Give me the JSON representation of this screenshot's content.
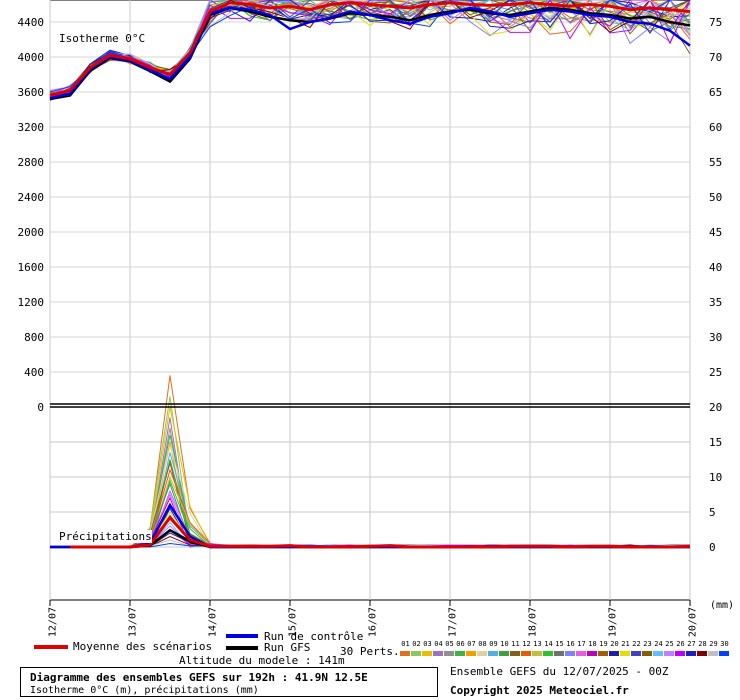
{
  "chart_data": {
    "type": "line",
    "title": "Diagramme des ensembles GEFS sur 192h : 41.9N 12.5E",
    "subtitle": "Isotherme 0°C (m), précipitations (mm)",
    "panels": [
      {
        "name": "Isotherme 0°C",
        "ylabel": "m",
        "yticks": [
          0,
          400,
          800,
          1200,
          1600,
          2000,
          2400,
          2800,
          3200,
          3600,
          4000,
          4400
        ],
        "ylim": [
          0,
          4600
        ],
        "x": [
          "12/07 00",
          "12/07 06",
          "12/07 12",
          "12/07 18",
          "13/07 00",
          "13/07 06",
          "13/07 12",
          "13/07 18",
          "14/07 00",
          "14/07 06",
          "14/07 12",
          "14/07 18",
          "15/07 00",
          "15/07 06",
          "15/07 12",
          "15/07 18",
          "16/07 00",
          "16/07 06",
          "16/07 12",
          "16/07 18",
          "17/07 00",
          "17/07 06",
          "17/07 12",
          "17/07 18",
          "18/07 00",
          "18/07 06",
          "18/07 12",
          "18/07 18",
          "19/07 00",
          "19/07 06",
          "19/07 12",
          "19/07 18",
          "20/07 00"
        ],
        "series": [
          {
            "name": "Moyenne des scénarios",
            "values": [
              3560,
              3620,
              3880,
              4020,
              3980,
              3880,
              3800,
              4050,
              4520,
              4620,
              4600,
              4560,
              4580,
              4540,
              4600,
              4620,
              4600,
              4580,
              4560,
              4600,
              4620,
              4600,
              4590,
              4600,
              4620,
              4600,
              4580,
              4600,
              4580,
              4540,
              4560,
              4540,
              4520
            ]
          },
          {
            "name": "Run de contrôle",
            "values": [
              3530,
              3580,
              3860,
              4000,
              3960,
              3850,
              3750,
              4000,
              4500,
              4560,
              4540,
              4480,
              4320,
              4400,
              4450,
              4520,
              4480,
              4420,
              4380,
              4460,
              4500,
              4560,
              4520,
              4460,
              4500,
              4540,
              4520,
              4480,
              4460,
              4400,
              4380,
              4300,
              4130
            ]
          },
          {
            "name": "Run GFS",
            "values": [
              3520,
              3560,
              3840,
              3990,
              3950,
              3840,
              3720,
              3980,
              4480,
              4560,
              4520,
              4460,
              4420,
              4400,
              4440,
              4500,
              4480,
              4460,
              4420,
              4480,
              4520,
              4540,
              4500,
              4480,
              4520,
              4560,
              4540,
              4500,
              4480,
              4440,
              4460,
              4400,
              4360
            ]
          }
        ]
      },
      {
        "name": "Précipitations",
        "ylabel": "mm",
        "yticks": [
          0,
          5,
          10,
          15,
          20
        ],
        "ylim": [
          0,
          20
        ],
        "x": [
          "12/07 00",
          "12/07 06",
          "12/07 12",
          "12/07 18",
          "13/07 00",
          "13/07 06",
          "13/07 12",
          "13/07 18",
          "14/07 00",
          "14/07 06",
          "14/07 12",
          "14/07 18",
          "15/07 00",
          "15/07 06",
          "15/07 12",
          "15/07 18",
          "16/07 00",
          "16/07 06",
          "16/07 12",
          "16/07 18",
          "17/07 00",
          "17/07 06",
          "17/07 12",
          "17/07 18",
          "18/07 00",
          "18/07 06",
          "18/07 12",
          "18/07 18",
          "19/07 00",
          "19/07 06",
          "19/07 12",
          "19/07 18",
          "20/07 00"
        ],
        "series": [
          {
            "name": "Moyenne des scénarios",
            "values": [
              0,
              0,
              0,
              0,
              0,
              0.3,
              4.2,
              1.0,
              0.1,
              0.1,
              0.1,
              0.1,
              0.2,
              0,
              0,
              0,
              0.1,
              0.2,
              0,
              0,
              0,
              0,
              0,
              0.1,
              0.1,
              0.1,
              0,
              0.1,
              0.1,
              0,
              0,
              0,
              0.1
            ]
          },
          {
            "name": "Run de contrôle",
            "values": [
              0,
              0,
              0,
              0,
              0,
              0.5,
              6.0,
              1.5,
              0,
              0,
              0,
              0,
              0,
              0,
              0,
              0,
              0,
              0,
              0,
              0,
              0,
              0,
              0,
              0,
              0,
              0,
              0,
              0,
              0,
              0,
              0,
              0,
              0
            ]
          },
          {
            "name": "Run GFS",
            "values": [
              0,
              0,
              0,
              0,
              0,
              0.2,
              2.4,
              0.8,
              0,
              0,
              0,
              0,
              0,
              0,
              0,
              0,
              0,
              0,
              0,
              0,
              0,
              0,
              0,
              0,
              0,
              0,
              0,
              0,
              0,
              0,
              0,
              0,
              0
            ]
          }
        ],
        "members_peak_13_07_12h": [
          24.5,
          21.5,
          20,
          18.5,
          17,
          16,
          15,
          14.5,
          13.5,
          12.5,
          12,
          11,
          10,
          9.5,
          9,
          8,
          7.5,
          7,
          6,
          5.5,
          5,
          4.5,
          4,
          3.5,
          3,
          2.5,
          2,
          1.5,
          1,
          0.5
        ]
      }
    ],
    "right_axis_ticks": [
      0,
      5,
      10,
      15,
      20,
      25,
      30,
      35,
      40,
      45,
      50,
      55,
      60,
      65,
      70,
      75
    ],
    "x_tick_labels": [
      "12/07",
      "13/07",
      "14/07",
      "15/07",
      "16/07",
      "17/07",
      "18/07",
      "19/07",
      "20/07"
    ],
    "right_unit_label": "(mm)",
    "grid": true,
    "legend": {
      "mean": "Moyenne des scénarios",
      "control": "Run de contrôle",
      "gfs": "Run GFS",
      "altitude": "Altitude du modele : 141m",
      "perts_label": "30 Perts.",
      "member_numbers": [
        "01",
        "02",
        "03",
        "04",
        "05",
        "06",
        "07",
        "08",
        "09",
        "10",
        "11",
        "12",
        "13",
        "14",
        "15",
        "16",
        "17",
        "18",
        "19",
        "20",
        "21",
        "22",
        "23",
        "24",
        "25",
        "26",
        "27",
        "28",
        "29",
        "30"
      ],
      "member_colors": [
        "#e07020",
        "#8cc860",
        "#e8c000",
        "#a070c0",
        "#909090",
        "#40b040",
        "#f0a000",
        "#e0d0a0",
        "#50b0e0",
        "#40a040",
        "#806020",
        "#e06000",
        "#c0c040",
        "#30c030",
        "#707070",
        "#8080ff",
        "#e060e0",
        "#c000c0",
        "#a06000",
        "#2020a0",
        "#e0e000",
        "#4040c0",
        "#806000",
        "#60c0ff",
        "#c080ff",
        "#c000ff",
        "#2020c0",
        "#800000",
        "#c0c0c0",
        "#0040ff"
      ],
      "mean_color": "#e00000",
      "control_color": "#0000e0",
      "gfs_color": "#000000"
    },
    "labels": {
      "isotherm": "Isotherme 0°C",
      "precip": "Précipitations",
      "ensemble_info": "Ensemble GEFS du 12/07/2025 - 00Z",
      "copyright": "Copyright 2025 Meteociel.fr"
    }
  }
}
